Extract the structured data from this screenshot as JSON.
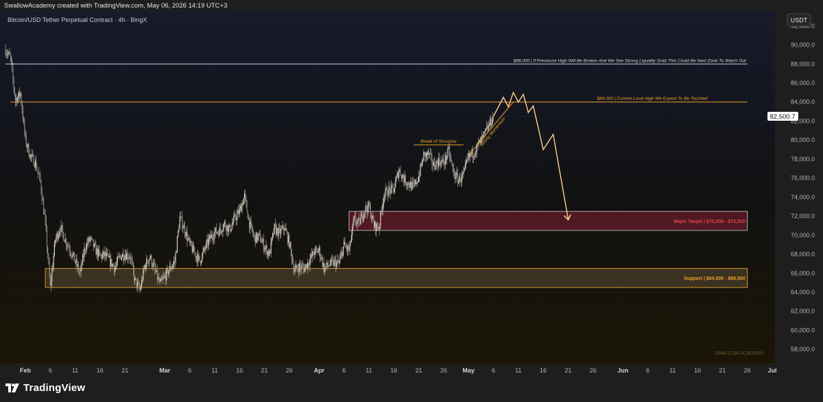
{
  "header": {
    "attribution": "SwallowAcademy created with TradingView.com, May 06, 2026 14:19 UTC+3"
  },
  "chart": {
    "symbol_title": "Bitcoin/USD Tether Perpetual Contract · 4h · BingX",
    "currency_button": "USDT",
    "last_price_label": "82,500.7",
    "watermark": "SWALLOW ACADEMY",
    "colors": {
      "background_top": "#161a2b",
      "background_bottom": "#1a1505",
      "candles": "#a9a49a",
      "annotation_orange": "#f0a030",
      "annotation_white": "#cfcfcf",
      "target_zone": "#5c1a26",
      "support_zone": "#5a4a33",
      "projection": "#ffd48a"
    }
  },
  "annotations": {
    "level_88k": "$88,000 | If Previouse High Will Be Broken And We See Strong Liquidity Grab This Could Be Next Zone To Watch Out",
    "level_84k": "$84,000 | Current Local High We Expect To Be Touched",
    "break_of_structure": "Break of Structure",
    "strong_momentum": "Strong Momentum",
    "major_target": "Major Target | $70,500 - $72,500",
    "support": "Support | $64,500 - $66,500"
  },
  "footer": {
    "logo_text": "TradingView",
    "logo_icon": "tradingview-logo-icon"
  },
  "chart_data": {
    "type": "candlestick",
    "title": "Bitcoin/USD Tether Perpetual Contract · 4h · BingX",
    "y_unit": "USDT",
    "ylim": [
      56500,
      93500
    ],
    "y_ticks": [
      "92,000.0",
      "90,000.0",
      "88,000.0",
      "86,000.0",
      "84,000.0",
      "82,000.0",
      "80,000.0",
      "78,000.0",
      "76,000.0",
      "74,000.0",
      "72,000.0",
      "70,000.0",
      "68,000.0",
      "66,000.0",
      "64,000.0",
      "62,000.0",
      "60,000.0",
      "58,000.0"
    ],
    "x_range": [
      "2026-01-28",
      "2026-07-01"
    ],
    "x_ticks": [
      {
        "date": "2026-02-01",
        "label": "Feb",
        "month": true
      },
      {
        "date": "2026-02-06",
        "label": "6"
      },
      {
        "date": "2026-02-11",
        "label": "11"
      },
      {
        "date": "2026-02-16",
        "label": "16"
      },
      {
        "date": "2026-02-21",
        "label": "21"
      },
      {
        "date": "2026-03-01",
        "label": "Mar",
        "month": true
      },
      {
        "date": "2026-03-06",
        "label": "6"
      },
      {
        "date": "2026-03-11",
        "label": "11"
      },
      {
        "date": "2026-03-16",
        "label": "16"
      },
      {
        "date": "2026-03-21",
        "label": "21"
      },
      {
        "date": "2026-03-26",
        "label": "26"
      },
      {
        "date": "2026-04-01",
        "label": "Apr",
        "month": true
      },
      {
        "date": "2026-04-06",
        "label": "6"
      },
      {
        "date": "2026-04-11",
        "label": "11"
      },
      {
        "date": "2026-04-16",
        "label": "16"
      },
      {
        "date": "2026-04-21",
        "label": "21"
      },
      {
        "date": "2026-04-26",
        "label": "26"
      },
      {
        "date": "2026-05-01",
        "label": "May",
        "month": true
      },
      {
        "date": "2026-05-06",
        "label": "6"
      },
      {
        "date": "2026-05-11",
        "label": "11"
      },
      {
        "date": "2026-05-16",
        "label": "16"
      },
      {
        "date": "2026-05-21",
        "label": "21"
      },
      {
        "date": "2026-05-26",
        "label": "26"
      },
      {
        "date": "2026-06-01",
        "label": "Jun",
        "month": true
      },
      {
        "date": "2026-06-06",
        "label": "6"
      },
      {
        "date": "2026-06-11",
        "label": "11"
      },
      {
        "date": "2026-06-16",
        "label": "16"
      },
      {
        "date": "2026-06-21",
        "label": "21"
      },
      {
        "date": "2026-06-26",
        "label": "26"
      },
      {
        "date": "2026-07-01",
        "label": "Jul",
        "month": true
      }
    ],
    "price_path": [
      [
        "2026-01-28",
        89500
      ],
      [
        "2026-01-29",
        88600
      ],
      [
        "2026-01-30",
        84200
      ],
      [
        "2026-01-31",
        84900
      ],
      [
        "2026-02-01",
        80000
      ],
      [
        "2026-02-02",
        78300
      ],
      [
        "2026-02-03",
        77600
      ],
      [
        "2026-02-04",
        75600
      ],
      [
        "2026-02-05",
        71200
      ],
      [
        "2026-02-06",
        64500
      ],
      [
        "2026-02-07",
        69500
      ],
      [
        "2026-02-08",
        70800
      ],
      [
        "2026-02-09",
        69500
      ],
      [
        "2026-02-10",
        68500
      ],
      [
        "2026-02-11",
        67200
      ],
      [
        "2026-02-12",
        66000
      ],
      [
        "2026-02-13",
        68800
      ],
      [
        "2026-02-14",
        69600
      ],
      [
        "2026-02-15",
        68500
      ],
      [
        "2026-02-16",
        67800
      ],
      [
        "2026-02-17",
        67900
      ],
      [
        "2026-02-18",
        67200
      ],
      [
        "2026-02-19",
        66600
      ],
      [
        "2026-02-20",
        67800
      ],
      [
        "2026-02-21",
        68000
      ],
      [
        "2026-02-22",
        67800
      ],
      [
        "2026-02-23",
        65200
      ],
      [
        "2026-02-24",
        64200
      ],
      [
        "2026-02-25",
        66800
      ],
      [
        "2026-02-26",
        67700
      ],
      [
        "2026-02-27",
        66300
      ],
      [
        "2026-02-28",
        64800
      ],
      [
        "2026-03-01",
        65600
      ],
      [
        "2026-03-02",
        66500
      ],
      [
        "2026-03-03",
        67200
      ],
      [
        "2026-03-04",
        71800
      ],
      [
        "2026-03-05",
        70600
      ],
      [
        "2026-03-06",
        69000
      ],
      [
        "2026-03-07",
        68100
      ],
      [
        "2026-03-08",
        67300
      ],
      [
        "2026-03-09",
        68500
      ],
      [
        "2026-03-10",
        69600
      ],
      [
        "2026-03-11",
        70300
      ],
      [
        "2026-03-12",
        70500
      ],
      [
        "2026-03-13",
        71200
      ],
      [
        "2026-03-14",
        70600
      ],
      [
        "2026-03-15",
        71700
      ],
      [
        "2026-03-16",
        72500
      ],
      [
        "2026-03-17",
        74100
      ],
      [
        "2026-03-18",
        71200
      ],
      [
        "2026-03-19",
        69700
      ],
      [
        "2026-03-20",
        69800
      ],
      [
        "2026-03-21",
        68800
      ],
      [
        "2026-03-22",
        68000
      ],
      [
        "2026-03-23",
        70700
      ],
      [
        "2026-03-24",
        70200
      ],
      [
        "2026-03-25",
        70800
      ],
      [
        "2026-03-26",
        69200
      ],
      [
        "2026-03-27",
        66300
      ],
      [
        "2026-03-28",
        66700
      ],
      [
        "2026-03-29",
        66500
      ],
      [
        "2026-03-30",
        67300
      ],
      [
        "2026-03-31",
        68200
      ],
      [
        "2026-04-01",
        68400
      ],
      [
        "2026-04-02",
        66500
      ],
      [
        "2026-04-03",
        66900
      ],
      [
        "2026-04-04",
        67100
      ],
      [
        "2026-04-05",
        67000
      ],
      [
        "2026-04-06",
        69000
      ],
      [
        "2026-04-07",
        68300
      ],
      [
        "2026-04-08",
        71600
      ],
      [
        "2026-04-09",
        71200
      ],
      [
        "2026-04-10",
        72600
      ],
      [
        "2026-04-11",
        73000
      ],
      [
        "2026-04-12",
        71000
      ],
      [
        "2026-04-13",
        70800
      ],
      [
        "2026-04-14",
        74300
      ],
      [
        "2026-04-15",
        74700
      ],
      [
        "2026-04-16",
        74800
      ],
      [
        "2026-04-17",
        76900
      ],
      [
        "2026-04-18",
        75900
      ],
      [
        "2026-04-19",
        75400
      ],
      [
        "2026-04-20",
        75000
      ],
      [
        "2026-04-21",
        76200
      ],
      [
        "2026-04-22",
        78400
      ],
      [
        "2026-04-23",
        78500
      ],
      [
        "2026-04-24",
        77300
      ],
      [
        "2026-04-25",
        77800
      ],
      [
        "2026-04-26",
        77600
      ],
      [
        "2026-04-27",
        78800
      ],
      [
        "2026-04-28",
        76500
      ],
      [
        "2026-04-29",
        75800
      ],
      [
        "2026-04-30",
        76300
      ],
      [
        "2026-05-01",
        78200
      ],
      [
        "2026-05-02",
        78700
      ],
      [
        "2026-05-03",
        79500
      ],
      [
        "2026-05-04",
        80300
      ],
      [
        "2026-05-05",
        81400
      ],
      [
        "2026-05-06",
        82500
      ]
    ],
    "horizontal_levels": [
      {
        "price": 88000,
        "from": "2026-01-28",
        "to": "2026-06-26",
        "label": "$88,000 | If Previouse High Will Be Broken And We See Strong Liquidity Grab This Could Be Next Zone To Watch Out"
      },
      {
        "price": 84000,
        "from": "2026-01-29",
        "to": "2026-06-26",
        "label": "$84,000 | Current Local High We Expect To Be Touched"
      },
      {
        "price": 79500,
        "from": "2026-04-20",
        "to": "2026-04-30",
        "label": "Break of Structure"
      }
    ],
    "zones": [
      {
        "name": "Major Target",
        "low": 70500,
        "high": 72500,
        "from": "2026-04-07",
        "to": "2026-06-26",
        "label": "Major Target | $70,500 - $72,500"
      },
      {
        "name": "Support",
        "low": 64500,
        "high": 66500,
        "from": "2026-02-05",
        "to": "2026-06-26",
        "label": "Support | $64,500 - $66,500"
      }
    ],
    "projection_path": [
      [
        "2026-05-06",
        82500
      ],
      [
        "2026-05-08",
        84500
      ],
      [
        "2026-05-09",
        83500
      ],
      [
        "2026-05-10",
        85000
      ],
      [
        "2026-05-11",
        84000
      ],
      [
        "2026-05-12",
        84800
      ],
      [
        "2026-05-13",
        82900
      ],
      [
        "2026-05-14",
        83600
      ],
      [
        "2026-05-16",
        79000
      ],
      [
        "2026-05-18",
        80600
      ],
      [
        "2026-05-21",
        71700
      ]
    ],
    "last_price": 82500.7
  }
}
